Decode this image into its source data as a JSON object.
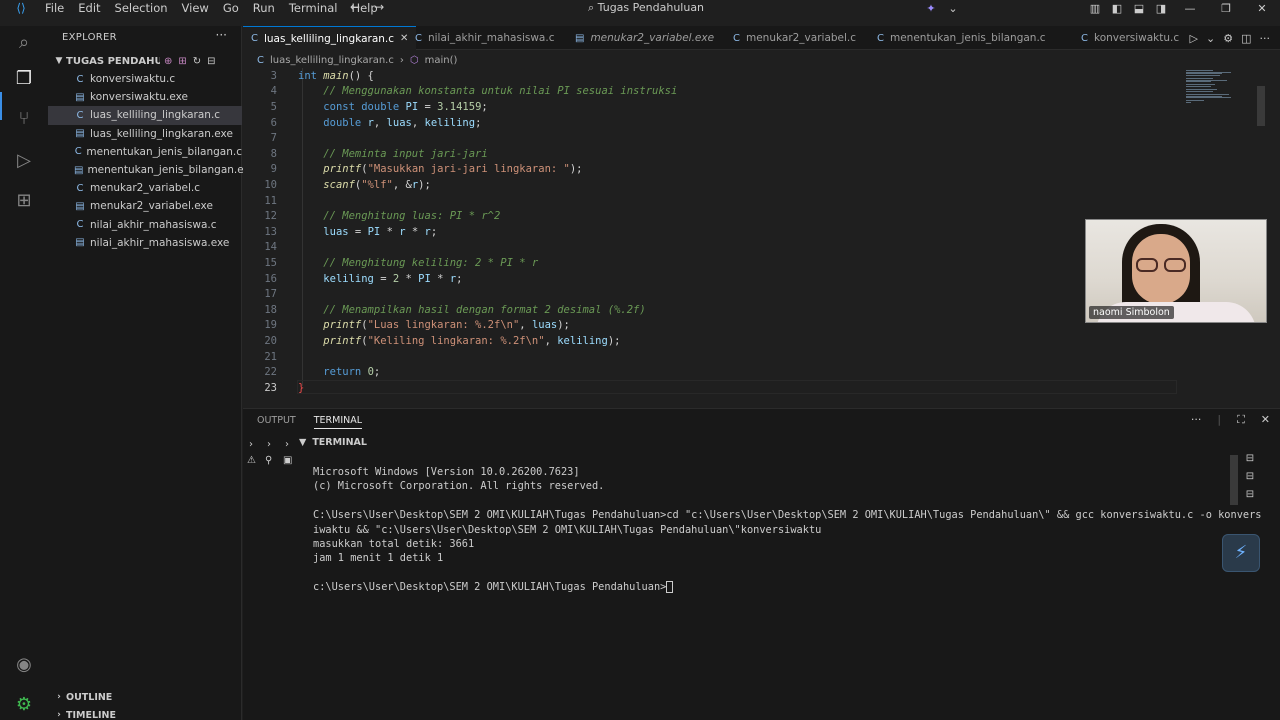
{
  "titlebar": {
    "menu": [
      "File",
      "Edit",
      "Selection",
      "View",
      "Go",
      "Run",
      "Terminal",
      "Help"
    ],
    "search": "Tugas Pendahuluan"
  },
  "explorer": {
    "header": "EXPLORER",
    "folder": "TUGAS PENDAHUL...",
    "files": [
      {
        "name": "konversiwaktu.c",
        "kind": "c"
      },
      {
        "name": "konversiwaktu.exe",
        "kind": "exe"
      },
      {
        "name": "luas_kelliling_lingkaran.c",
        "kind": "c",
        "selected": true
      },
      {
        "name": "luas_kelliling_lingkaran.exe",
        "kind": "exe"
      },
      {
        "name": "menentukan_jenis_bilangan.c",
        "kind": "c"
      },
      {
        "name": "menentukan_jenis_bilangan.exe",
        "kind": "exe"
      },
      {
        "name": "menukar2_variabel.c",
        "kind": "c"
      },
      {
        "name": "menukar2_variabel.exe",
        "kind": "exe"
      },
      {
        "name": "nilai_akhir_mahasiswa.c",
        "kind": "c"
      },
      {
        "name": "nilai_akhir_mahasiswa.exe",
        "kind": "exe"
      }
    ],
    "outline": "OUTLINE",
    "timeline": "TIMELINE"
  },
  "tabs": [
    {
      "label": "luas_kelliling_lingkaran.c",
      "active": true,
      "kind": "c"
    },
    {
      "label": "nilai_akhir_mahasiswa.c",
      "kind": "c"
    },
    {
      "label": "menukar2_variabel.exe",
      "kind": "exe",
      "italic": true
    },
    {
      "label": "menukar2_variabel.c",
      "kind": "c"
    },
    {
      "label": "menentukan_jenis_bilangan.c",
      "kind": "c"
    },
    {
      "label": "konversiwaktu.c",
      "kind": "c"
    }
  ],
  "breadcrumb": {
    "file": "luas_kelliling_lingkaran.c",
    "symbol": "main()"
  },
  "editor": {
    "lines": [
      {
        "n": "3",
        "html": "<span class=\"t\">int</span> <span class=\"fn\">main</span><span class=\"p\">() {</span>"
      },
      {
        "n": "4",
        "html": "    <span class=\"cm\">// Menggunakan konstanta untuk nilai PI sesuai instruksi</span>"
      },
      {
        "n": "5",
        "html": "    <span class=\"k\">const</span> <span class=\"t\">double</span> <span class=\"v\">PI</span> <span class=\"p\">=</span> <span class=\"n\">3.14159</span><span class=\"p\">;</span>"
      },
      {
        "n": "6",
        "html": "    <span class=\"t\">double</span> <span class=\"v\">r</span><span class=\"p\">,</span> <span class=\"v\">luas</span><span class=\"p\">,</span> <span class=\"v\">keliling</span><span class=\"p\">;</span>"
      },
      {
        "n": "7",
        "html": ""
      },
      {
        "n": "8",
        "html": "    <span class=\"cm\">// Meminta input jari-jari</span>"
      },
      {
        "n": "9",
        "html": "    <span class=\"fn\">printf</span><span class=\"p\">(</span><span class=\"s\">\"Masukkan jari-jari lingkaran: \"</span><span class=\"p\">);</span>"
      },
      {
        "n": "10",
        "html": "    <span class=\"fn\">scanf</span><span class=\"p\">(</span><span class=\"s\">\"%lf\"</span><span class=\"p\">, &amp;</span><span class=\"v\">r</span><span class=\"p\">);</span>"
      },
      {
        "n": "11",
        "html": ""
      },
      {
        "n": "12",
        "html": "    <span class=\"cm\">// Menghitung luas: PI * r^2</span>"
      },
      {
        "n": "13",
        "html": "    <span class=\"v\">luas</span> <span class=\"p\">=</span> <span class=\"v\">PI</span> <span class=\"p\">*</span> <span class=\"v\">r</span> <span class=\"p\">*</span> <span class=\"v\">r</span><span class=\"p\">;</span>"
      },
      {
        "n": "14",
        "html": ""
      },
      {
        "n": "15",
        "html": "    <span class=\"cm\">// Menghitung keliling: 2 * PI * r</span>"
      },
      {
        "n": "16",
        "html": "    <span class=\"v\">keliling</span> <span class=\"p\">=</span> <span class=\"n\">2</span> <span class=\"p\">*</span> <span class=\"v\">PI</span> <span class=\"p\">*</span> <span class=\"v\">r</span><span class=\"p\">;</span>"
      },
      {
        "n": "17",
        "html": ""
      },
      {
        "n": "18",
        "html": "    <span class=\"cm\">// Menampilkan hasil dengan format 2 desimal (%.2f)</span>"
      },
      {
        "n": "19",
        "html": "    <span class=\"fn\">printf</span><span class=\"p\">(</span><span class=\"s\">\"Luas lingkaran: %.2f\\n\"</span><span class=\"p\">,</span> <span class=\"v\">luas</span><span class=\"p\">);</span>"
      },
      {
        "n": "20",
        "html": "    <span class=\"fn\">printf</span><span class=\"p\">(</span><span class=\"s\">\"Keliling lingkaran: %.2f\\n\"</span><span class=\"p\">,</span> <span class=\"v\">keliling</span><span class=\"p\">);</span>"
      },
      {
        "n": "21",
        "html": ""
      },
      {
        "n": "22",
        "html": "    <span class=\"k\">return</span> <span class=\"n\">0</span><span class=\"p\">;</span>"
      },
      {
        "n": "23",
        "html": "<span class=\"cmt-red\">}</span>",
        "current": true
      }
    ]
  },
  "panel": {
    "tabs": [
      "OUTPUT",
      "TERMINAL"
    ],
    "active_tab": "TERMINAL",
    "terminal_header": "TERMINAL",
    "terminal_lines": [
      "Microsoft Windows [Version 10.0.26200.7623]",
      "(c) Microsoft Corporation. All rights reserved.",
      "",
      "C:\\Users\\User\\Desktop\\SEM 2 OMI\\KULIAH\\Tugas Pendahuluan>cd \"c:\\Users\\User\\Desktop\\SEM 2 OMI\\KULIAH\\Tugas Pendahuluan\\\" && gcc konversiwaktu.c -o konvers",
      "iwaktu && \"c:\\Users\\User\\Desktop\\SEM 2 OMI\\KULIAH\\Tugas Pendahuluan\\\"konversiwaktu",
      "masukkan total detik: 3661",
      "jam 1 menit 1 detik 1",
      ""
    ],
    "prompt": "c:\\Users\\User\\Desktop\\SEM 2 OMI\\KULIAH\\Tugas Pendahuluan>"
  },
  "webcam": {
    "name": "naomi Simbolon"
  },
  "colors": {
    "accent": "#0078d4",
    "background": "#1f1f1f",
    "sidebar": "#181818"
  }
}
